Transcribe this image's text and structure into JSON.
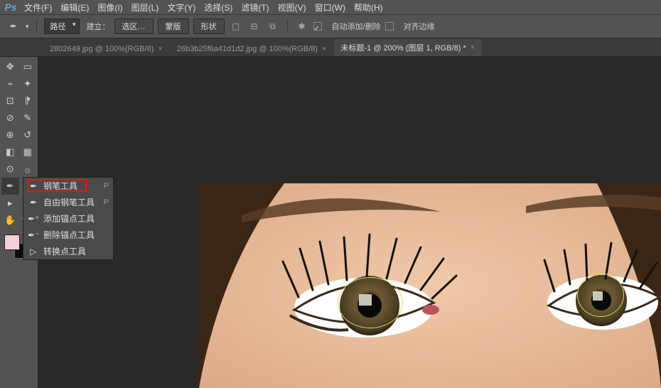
{
  "app": {
    "logo": "Ps"
  },
  "menubar": [
    "文件(F)",
    "编辑(E)",
    "图像(I)",
    "图层(L)",
    "文字(Y)",
    "选择(S)",
    "滤镜(T)",
    "视图(V)",
    "窗口(W)",
    "帮助(H)"
  ],
  "options": {
    "mode_dropdown": "路径",
    "build_label": "建立：",
    "btn_selection": "选区…",
    "btn_mask": "蒙版",
    "btn_shape": "形状",
    "auto_add_delete": "自动添加/删除",
    "align_edges": "对齐边缘"
  },
  "tabs": [
    {
      "label": "2802649.jpg @ 100%(RGB/8)"
    },
    {
      "label": "26b3b25f6a41d1d2.jpg @ 100%(RGB/8)"
    },
    {
      "label": "未标题-1 @ 200% (图层 1, RGB/8) *",
      "active": true
    }
  ],
  "flyout": {
    "items": [
      {
        "icon": "✒",
        "label": "钢笔工具",
        "shortcut": "P"
      },
      {
        "icon": "✒",
        "label": "自由钢笔工具",
        "shortcut": "P"
      },
      {
        "icon": "✒⁺",
        "label": "添加锚点工具",
        "shortcut": ""
      },
      {
        "icon": "✒⁻",
        "label": "删除锚点工具",
        "shortcut": ""
      },
      {
        "icon": "▷",
        "label": "转换点工具",
        "shortcut": ""
      }
    ]
  },
  "colors": {
    "fg": "#f4cfd8",
    "bg": "#0e0e0e"
  }
}
